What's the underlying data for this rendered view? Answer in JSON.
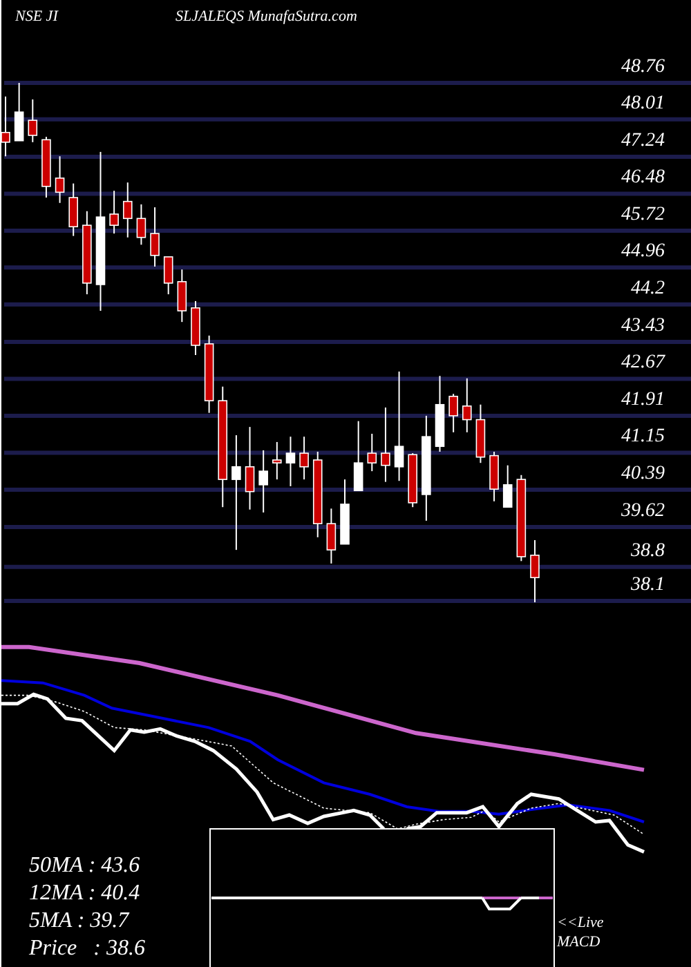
{
  "header": {
    "exchange_symbol": "NSE JI",
    "title": "SLJALEQS MunafaSutra.com"
  },
  "chart_data": {
    "type": "candlestick",
    "ylim": [
      38.1,
      48.76
    ],
    "grid": true,
    "yticks": [
      48.76,
      48.01,
      47.24,
      46.48,
      45.72,
      44.96,
      44.2,
      43.43,
      42.67,
      41.91,
      41.15,
      40.39,
      39.62,
      38.8,
      38.1
    ],
    "ohlc": [
      [
        47.74,
        48.48,
        47.25,
        47.54
      ],
      [
        47.57,
        48.76,
        47.57,
        48.16
      ],
      [
        47.99,
        48.42,
        47.54,
        47.68
      ],
      [
        47.59,
        47.65,
        46.4,
        46.63
      ],
      [
        46.8,
        47.25,
        46.29,
        46.51
      ],
      [
        46.4,
        46.69,
        45.61,
        45.8
      ],
      [
        45.83,
        46.12,
        44.41,
        44.64
      ],
      [
        44.61,
        47.34,
        44.07,
        46.0
      ],
      [
        46.06,
        46.54,
        45.66,
        45.83
      ],
      [
        46.32,
        46.71,
        45.58,
        45.97
      ],
      [
        45.97,
        46.26,
        45.43,
        45.58
      ],
      [
        45.66,
        46.2,
        44.98,
        45.21
      ],
      [
        45.18,
        45.18,
        44.41,
        44.64
      ],
      [
        44.67,
        44.92,
        43.84,
        44.07
      ],
      [
        44.13,
        44.27,
        43.16,
        43.36
      ],
      [
        43.39,
        43.56,
        41.97,
        42.22
      ],
      [
        42.22,
        42.51,
        40.03,
        40.6
      ],
      [
        40.6,
        41.51,
        39.15,
        40.86
      ],
      [
        40.86,
        41.68,
        39.98,
        40.35
      ],
      [
        40.49,
        41.2,
        39.92,
        40.77
      ],
      [
        41.0,
        41.37,
        40.6,
        40.94
      ],
      [
        40.94,
        41.48,
        40.46,
        41.14
      ],
      [
        41.14,
        41.48,
        40.6,
        40.86
      ],
      [
        41.0,
        41.17,
        39.41,
        39.69
      ],
      [
        39.69,
        40.0,
        38.87,
        39.15
      ],
      [
        39.27,
        40.6,
        39.27,
        40.09
      ],
      [
        40.37,
        41.8,
        40.37,
        40.94
      ],
      [
        41.14,
        41.54,
        40.77,
        40.94
      ],
      [
        41.14,
        42.08,
        40.55,
        40.89
      ],
      [
        40.86,
        42.82,
        40.57,
        41.28
      ],
      [
        41.11,
        41.14,
        40.03,
        40.12
      ],
      [
        40.29,
        41.91,
        39.75,
        41.48
      ],
      [
        41.28,
        42.73,
        41.17,
        42.14
      ],
      [
        42.31,
        42.36,
        41.57,
        41.91
      ],
      [
        42.11,
        42.68,
        41.57,
        41.83
      ],
      [
        41.83,
        42.14,
        40.94,
        41.06
      ],
      [
        41.09,
        41.17,
        40.15,
        40.4
      ],
      [
        40.03,
        40.89,
        40.03,
        40.49
      ],
      [
        40.6,
        40.69,
        38.92,
        39.01
      ],
      [
        39.04,
        39.35,
        38.07,
        38.58
      ]
    ]
  },
  "legend": [
    "50MA : 43.6",
    "12MA : 40.4",
    "5MA : 39.7",
    "Price   : 38.6"
  ],
  "macd": {
    "labels": [
      "<<Live",
      "MACD"
    ]
  }
}
